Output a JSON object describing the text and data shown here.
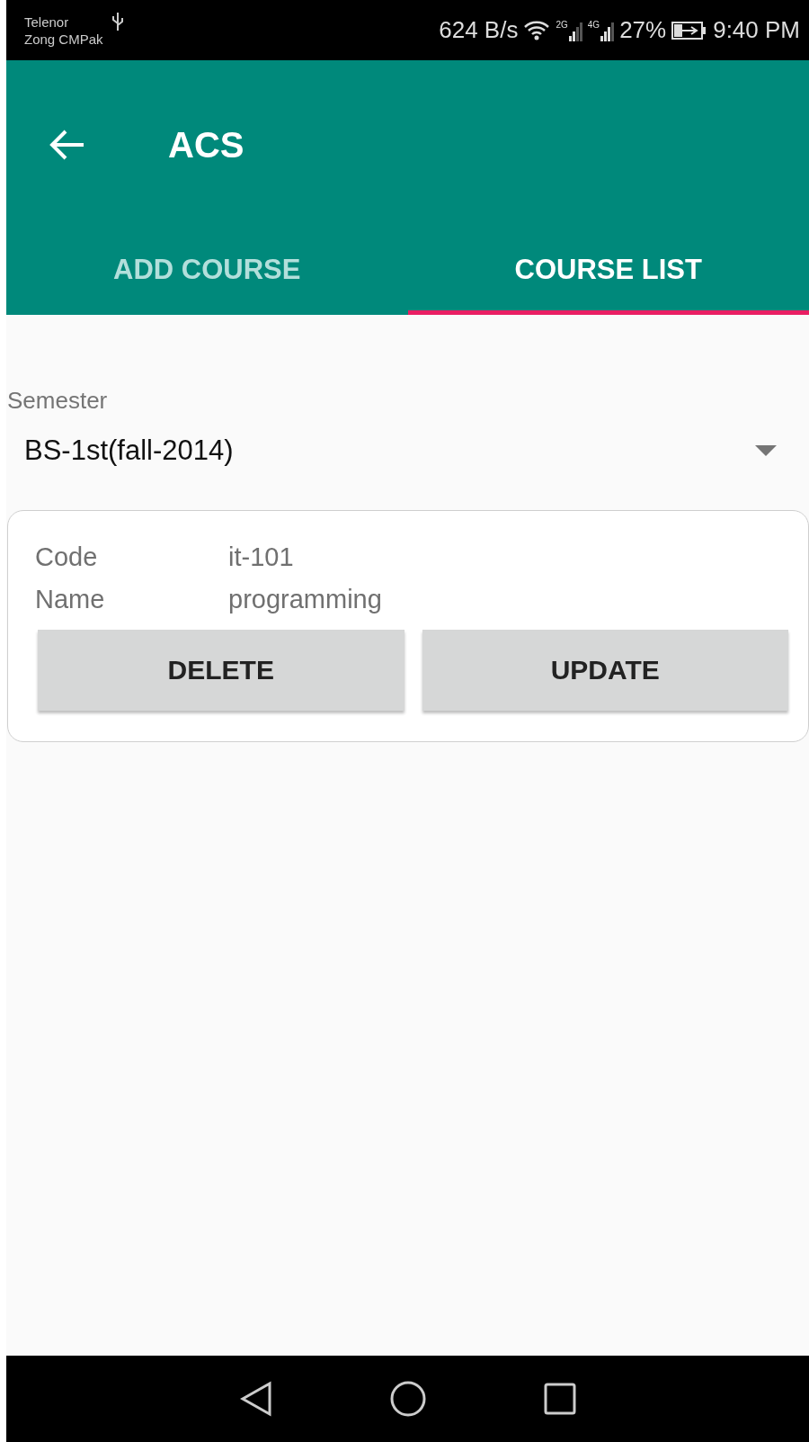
{
  "status_bar": {
    "carriers": [
      "Telenor",
      "Zong CMPak"
    ],
    "speed": "624 B/s",
    "signals": [
      {
        "label": "2G",
        "level": 0.5
      },
      {
        "label": "4G",
        "level": 0.75
      }
    ],
    "battery": "27%",
    "charging": true,
    "time": "9:40 PM"
  },
  "toolbar": {
    "title": "ACS"
  },
  "tabs": [
    {
      "label": "ADD COURSE",
      "selected": false
    },
    {
      "label": "COURSE LIST",
      "selected": true
    }
  ],
  "semester": {
    "label": "Semester",
    "value": "BS-1st(fall-2014)"
  },
  "courses": [
    {
      "fields": [
        {
          "label": "Code",
          "value": "it-101"
        },
        {
          "label": "Name",
          "value": "programming"
        }
      ],
      "buttons": [
        "DELETE",
        "UPDATE"
      ]
    }
  ]
}
